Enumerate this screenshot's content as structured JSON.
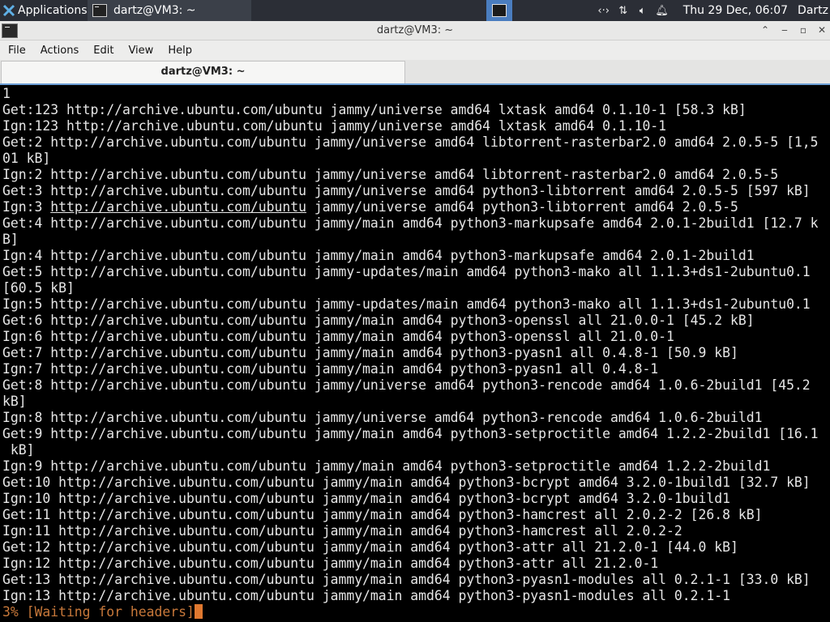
{
  "panel": {
    "apps_label": "Applications",
    "task_label": "dartz@VM3: ~",
    "clock": "Thu 29 Dec, 06:07",
    "user": "Dartz",
    "icons": [
      "code-icon",
      "network-icon",
      "volume-icon",
      "notification-bell-icon"
    ]
  },
  "window": {
    "title": "dartz@VM3: ~",
    "menu": [
      "File",
      "Actions",
      "Edit",
      "View",
      "Help"
    ],
    "tab_label": "dartz@VM3: ~"
  },
  "terminal": {
    "lines": [
      "1",
      "Get:123 http://archive.ubuntu.com/ubuntu jammy/universe amd64 lxtask amd64 0.1.10-1 [58.3 kB]",
      "Ign:123 http://archive.ubuntu.com/ubuntu jammy/universe amd64 lxtask amd64 0.1.10-1",
      "Get:2 http://archive.ubuntu.com/ubuntu jammy/universe amd64 libtorrent-rasterbar2.0 amd64 2.0.5-5 [1,5",
      "01 kB]",
      "Ign:2 http://archive.ubuntu.com/ubuntu jammy/universe amd64 libtorrent-rasterbar2.0 amd64 2.0.5-5",
      "Get:3 http://archive.ubuntu.com/ubuntu jammy/universe amd64 python3-libtorrent amd64 2.0.5-5 [597 kB]",
      "Ign:3 http://archive.ubuntu.com/ubuntu jammy/universe amd64 python3-libtorrent amd64 2.0.5-5",
      "Get:4 http://archive.ubuntu.com/ubuntu jammy/main amd64 python3-markupsafe amd64 2.0.1-2build1 [12.7 k",
      "B]",
      "Ign:4 http://archive.ubuntu.com/ubuntu jammy/main amd64 python3-markupsafe amd64 2.0.1-2build1",
      "Get:5 http://archive.ubuntu.com/ubuntu jammy-updates/main amd64 python3-mako all 1.1.3+ds1-2ubuntu0.1",
      "[60.5 kB]",
      "Ign:5 http://archive.ubuntu.com/ubuntu jammy-updates/main amd64 python3-mako all 1.1.3+ds1-2ubuntu0.1",
      "Get:6 http://archive.ubuntu.com/ubuntu jammy/main amd64 python3-openssl all 21.0.0-1 [45.2 kB]",
      "Ign:6 http://archive.ubuntu.com/ubuntu jammy/main amd64 python3-openssl all 21.0.0-1",
      "Get:7 http://archive.ubuntu.com/ubuntu jammy/main amd64 python3-pyasn1 all 0.4.8-1 [50.9 kB]",
      "Ign:7 http://archive.ubuntu.com/ubuntu jammy/main amd64 python3-pyasn1 all 0.4.8-1",
      "Get:8 http://archive.ubuntu.com/ubuntu jammy/universe amd64 python3-rencode amd64 1.0.6-2build1 [45.2",
      "kB]",
      "Ign:8 http://archive.ubuntu.com/ubuntu jammy/universe amd64 python3-rencode amd64 1.0.6-2build1",
      "Get:9 http://archive.ubuntu.com/ubuntu jammy/main amd64 python3-setproctitle amd64 1.2.2-2build1 [16.1",
      " kB]",
      "Ign:9 http://archive.ubuntu.com/ubuntu jammy/main amd64 python3-setproctitle amd64 1.2.2-2build1",
      "Get:10 http://archive.ubuntu.com/ubuntu jammy/main amd64 python3-bcrypt amd64 3.2.0-1build1 [32.7 kB]",
      "Ign:10 http://archive.ubuntu.com/ubuntu jammy/main amd64 python3-bcrypt amd64 3.2.0-1build1",
      "Get:11 http://archive.ubuntu.com/ubuntu jammy/main amd64 python3-hamcrest all 2.0.2-2 [26.8 kB]",
      "Ign:11 http://archive.ubuntu.com/ubuntu jammy/main amd64 python3-hamcrest all 2.0.2-2",
      "Get:12 http://archive.ubuntu.com/ubuntu jammy/main amd64 python3-attr all 21.2.0-1 [44.0 kB]",
      "Ign:12 http://archive.ubuntu.com/ubuntu jammy/main amd64 python3-attr all 21.2.0-1",
      "Get:13 http://archive.ubuntu.com/ubuntu jammy/main amd64 python3-pyasn1-modules all 0.2.1-1 [33.0 kB]",
      "Ign:13 http://archive.ubuntu.com/ubuntu jammy/main amd64 python3-pyasn1-modules all 0.2.1-1"
    ],
    "progress": "3% [Waiting for headers]"
  }
}
